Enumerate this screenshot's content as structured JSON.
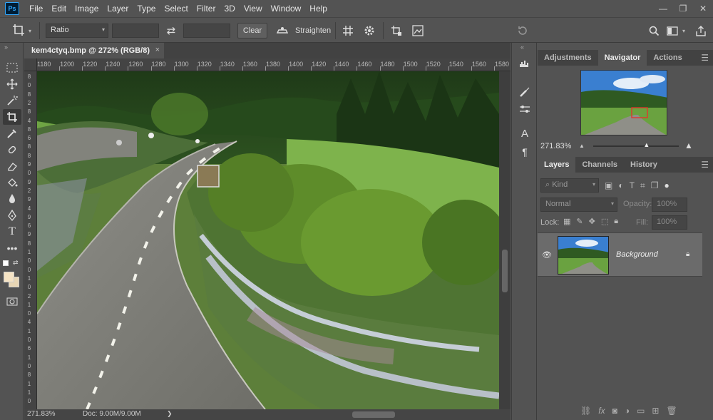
{
  "app": {
    "logo": "Ps"
  },
  "menu": [
    "File",
    "Edit",
    "Image",
    "Layer",
    "Type",
    "Select",
    "Filter",
    "3D",
    "View",
    "Window",
    "Help"
  ],
  "window_controls": {
    "minimize": "—",
    "restore": "❐",
    "close": "✕"
  },
  "options": {
    "ratio_label": "Ratio",
    "width_value": "",
    "height_value": "",
    "swap_icon": "⇄",
    "clear_label": "Clear",
    "straighten_label": "Straighten"
  },
  "document": {
    "tab_title": "kem4ctyq.bmp @ 272% (RGB/8)",
    "tab_close": "×",
    "ruler_h": [
      "1180",
      "1200",
      "1220",
      "1240",
      "1260",
      "1280",
      "1300",
      "1320",
      "1340",
      "1360",
      "1380",
      "1400",
      "1420",
      "1440",
      "1460",
      "1480",
      "1500",
      "1520",
      "1540",
      "1560",
      "1580"
    ],
    "ruler_v": [
      "8",
      "0",
      "8",
      "2",
      "8",
      "4",
      "8",
      "6",
      "8",
      "8",
      "9",
      "0",
      "9",
      "2",
      "9",
      "4",
      "9",
      "6",
      "9",
      "8",
      "1",
      "0",
      "0",
      "1",
      "0",
      "2",
      "1",
      "0",
      "4",
      "1",
      "0",
      "6",
      "1",
      "0",
      "8",
      "1",
      "1",
      "0"
    ],
    "zoom": "271.83%",
    "doc_info": "Doc: 9.00M/9.00M",
    "status_arrow": "❯"
  },
  "navigator": {
    "tabs": [
      "Adjustments",
      "Navigator",
      "Actions"
    ],
    "active_tab": "Navigator",
    "zoom": "271.83%",
    "zoom_slider": 0.62
  },
  "layers": {
    "tabs": [
      "Layers",
      "Channels",
      "History"
    ],
    "active_tab": "Layers",
    "kind_label": "Kind",
    "blend_mode": "Normal",
    "opacity_label": "Opacity:",
    "opacity_value": "100%",
    "lock_label": "Lock:",
    "fill_label": "Fill:",
    "fill_value": "100%",
    "items": [
      {
        "name": "Background",
        "visible": true,
        "locked": true
      }
    ]
  },
  "colors": {
    "accent": "#31a8ff",
    "panel": "#535353",
    "dark": "#424242",
    "foreground": "#f5e3c4",
    "background": "#e8d6b4"
  }
}
